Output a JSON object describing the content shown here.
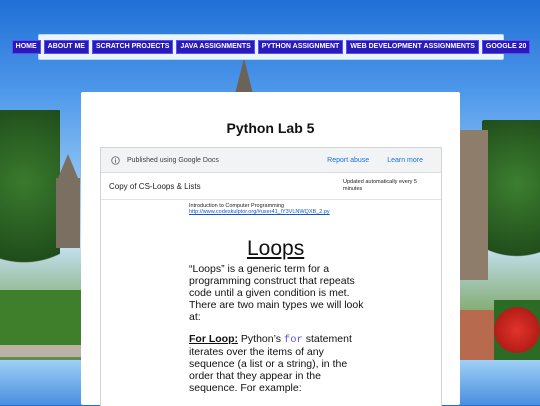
{
  "nav": {
    "items": [
      {
        "label": "HOME"
      },
      {
        "label": "ABOUT ME"
      },
      {
        "label": "SCRATCH PROJECTS"
      },
      {
        "label": "JAVA ASSIGNMENTS"
      },
      {
        "label": "PYTHON ASSIGNMENT"
      },
      {
        "label": "WEB DEVELOPMENT ASSIGNMENTS"
      },
      {
        "label": "GOOGLE 20"
      }
    ]
  },
  "page": {
    "title": "Python Lab 5"
  },
  "doc": {
    "published": "Published using Google Docs",
    "report_abuse": "Report abuse",
    "learn_more": "Learn more",
    "doc_title": "Copy of CS-Loops & Lists",
    "updated": "Updated automatically every 5 minutes",
    "intro_text": "Introduction to Computer Programming",
    "intro_link": "http://www.codeskulptor.org/#user41_lY3VLNWQXB_2.py",
    "heading": "Loops",
    "para1": "“Loops” is a generic term for a programming construct that repeats code until a given condition is met.  There are two main types we will look at:",
    "for_loop_label": "For Loop:",
    "para2_a": "Python’s",
    "para2_code": "for",
    "para2_b": "statement iterates over the items of any sequence (a list or a string), in the order that they appear in the sequence. For example:"
  },
  "colors": {
    "nav_button": "#2a1ab8",
    "link": "#1a73e8",
    "code": "#5b5bd6"
  }
}
